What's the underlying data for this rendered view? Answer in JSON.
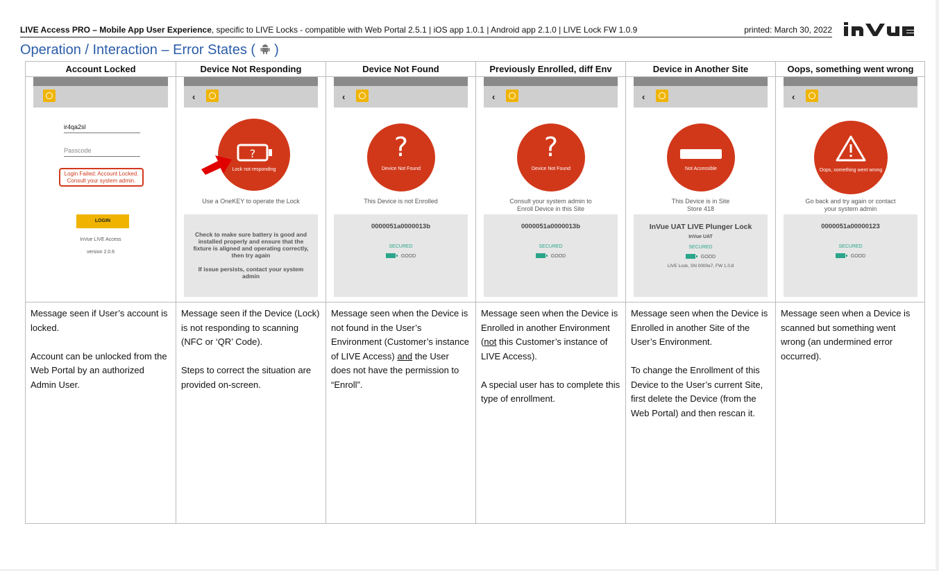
{
  "header": {
    "bold": "LIVE Access PRO – Mobile App User Experience",
    "rest": ", specific to LIVE Locks - compatible with Web Portal 2.5.1 | iOS app 1.0.1 | Android app 2.1.0 | LIVE Lock FW 1.0.9",
    "printed": "printed: March 30, 2022",
    "logo": "InVUE"
  },
  "title": {
    "text": "Operation / Interaction – Error States (",
    "close": " )"
  },
  "columns": [
    {
      "heading": "Account Locked",
      "screen": {
        "username": "ir4qa2sl",
        "passcode_placeholder": "Passcode",
        "error": "Login Failed: Account Locked. Consult your system admin.",
        "login": "LOGIN",
        "app_name": "InVue LIVE Access",
        "version": "version 2.0.6"
      },
      "desc": [
        "Message seen if User’s account is locked.",
        "Account can be unlocked from the Web Portal by an authorized Admin User."
      ]
    },
    {
      "heading": "Device Not Responding",
      "screen": {
        "circle_text": "Lock not responding",
        "sub": "Use a OneKEY to operate the Lock",
        "panel1": "Check to make sure battery is good and installed properly and ensure that the fixture is aligned and operating correctly, then try again",
        "panel2": "If issue persists, contact your system admin"
      },
      "desc": [
        "Message seen if the Device (Lock) is not responding to scanning (NFC or ‘QR’ Code).",
        "Steps to correct the situation are provided on-screen."
      ]
    },
    {
      "heading": "Device Not Found",
      "screen": {
        "circle_text": "Device Not Found",
        "sub": "This Device is not Enrolled",
        "sn": "0000051a0000013b",
        "secured": "SECURED",
        "battery": "GOOD"
      },
      "desc_html": "Message seen when the Device is not found in the User’s Environment (Customer’s instance of LIVE Access) <u>and</u> the User does not have the permission to “Enroll”."
    },
    {
      "heading": "Previously Enrolled, diff Env",
      "screen": {
        "circle_text": "Device Not Found",
        "sub": "Consult your system admin to Enroll Device in this Site",
        "sn": "0000051a0000013b",
        "secured": "SECURED",
        "battery": "GOOD"
      },
      "desc_html": "Message seen when the Device is Enrolled in another Environment (<u>not</u> this Customer’s instance of LIVE Access).",
      "desc2": "A special user has to complete this type of enrollment."
    },
    {
      "heading": "Device in Another Site",
      "screen": {
        "circle_text": "Not Accessible",
        "sub1": "This Device is in Site",
        "sub2": "Store 418",
        "sn": "InVue UAT LIVE Plunger Lock",
        "org": "InVue UAT",
        "secured": "SECURED",
        "battery": "GOOD",
        "fw": "LIVE Lock, SN 0000e7, FW 1.0.8"
      },
      "desc": [
        "Message seen when the Device is Enrolled in another Site of the User’s Environment.",
        "To change the Enrollment of this Device to the User’s current Site, first delete the Device (from the Web Portal) and then rescan it."
      ]
    },
    {
      "heading": "Oops, something went wrong",
      "screen": {
        "circle_text": "Oops, something went wrong",
        "sub": "Go back and try again or contact your system admin",
        "sn": "0000051a00000123",
        "secured": "SECURED",
        "battery": "GOOD"
      },
      "desc": [
        "Message seen when a Device is scanned but something went wrong (an undermined error occurred)."
      ]
    }
  ]
}
